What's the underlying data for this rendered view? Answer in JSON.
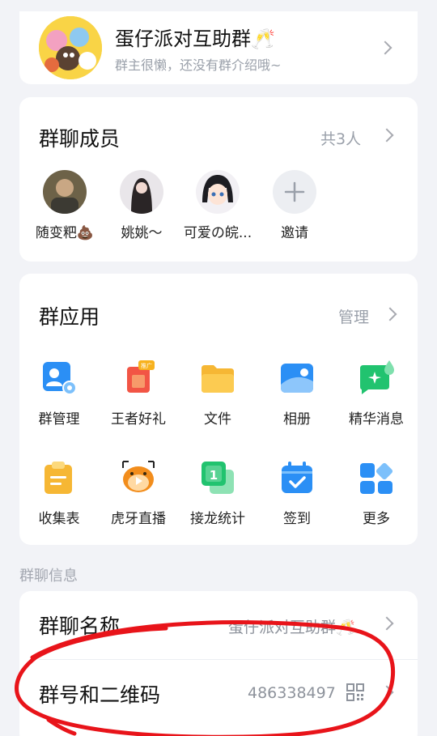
{
  "group": {
    "name": "蛋仔派对互助群🥂",
    "description": "群主很懒，还没有群介绍哦~"
  },
  "members": {
    "title": "群聊成员",
    "count_label": "共3人",
    "items": [
      {
        "name": "随变粑💩"
      },
      {
        "name": "姚姚～"
      },
      {
        "name": "可爱の皖..."
      },
      {
        "name": "邀请"
      }
    ]
  },
  "apps": {
    "title": "群应用",
    "manage_label": "管理",
    "badge": "推广",
    "items": [
      {
        "label": "群管理",
        "icon": "group-manage-icon"
      },
      {
        "label": "王者好礼",
        "icon": "gift-icon"
      },
      {
        "label": "文件",
        "icon": "folder-icon"
      },
      {
        "label": "相册",
        "icon": "album-icon"
      },
      {
        "label": "精华消息",
        "icon": "essence-message-icon"
      },
      {
        "label": "收集表",
        "icon": "clipboard-icon"
      },
      {
        "label": "虎牙直播",
        "icon": "huya-live-icon"
      },
      {
        "label": "接龙统计",
        "icon": "relay-stats-icon"
      },
      {
        "label": "签到",
        "icon": "checkin-calendar-icon"
      },
      {
        "label": "更多",
        "icon": "more-apps-icon"
      }
    ]
  },
  "info": {
    "section_label": "群聊信息",
    "name_row": {
      "label": "群聊名称",
      "value": "蛋仔派对互助群🥂"
    },
    "number_row": {
      "label": "群号和二维码",
      "value": "486338497"
    }
  },
  "colors": {
    "accent_blue": "#2b8ff5",
    "annotation_red": "#e8141a"
  }
}
